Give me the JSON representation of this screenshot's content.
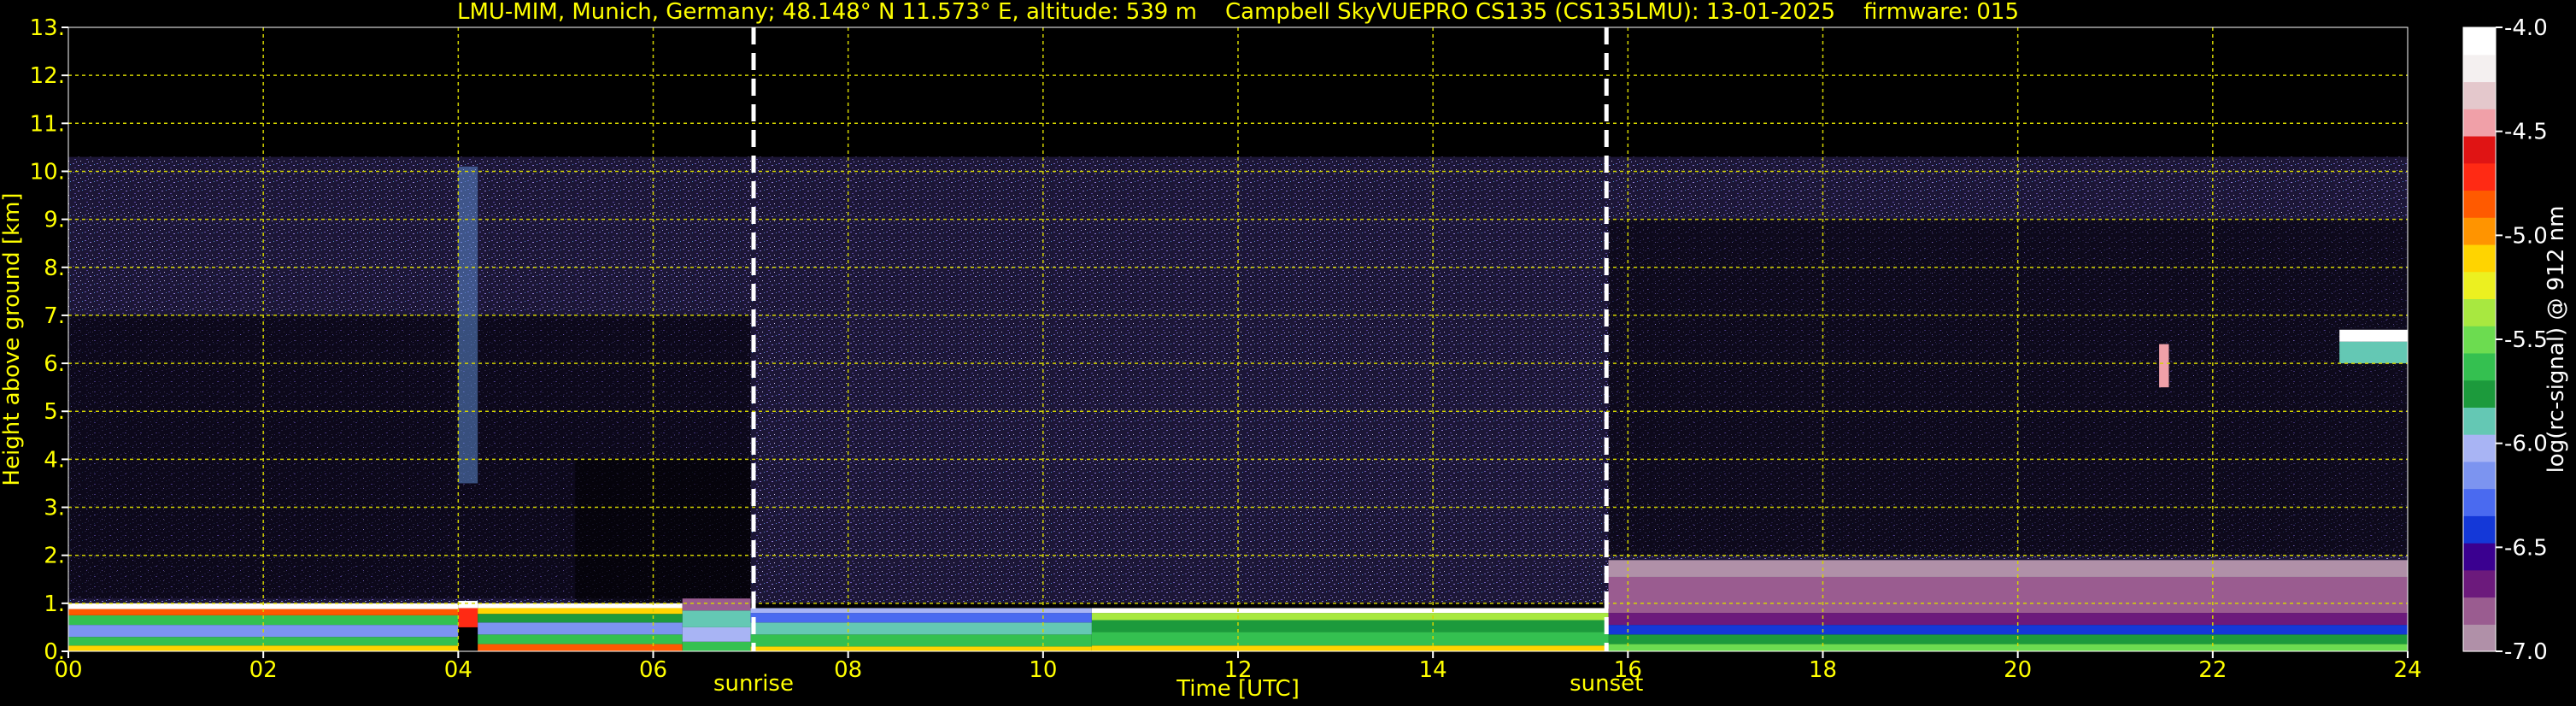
{
  "chart_data": {
    "type": "heatmap",
    "title": "LMU-MIM, Munich, Germany; 48.148° N 11.573° E, altitude: 539 m    Campbell SkyVUEPRO CS135 (CS135LMU): 13-01-2025    firmware: 015",
    "xlabel": "Time [UTC]",
    "ylabel": "Height above ground [km]",
    "xlim": [
      0,
      24
    ],
    "ylim": [
      0,
      13
    ],
    "x_ticks": [
      "00",
      "02",
      "04",
      "06",
      "08",
      "10",
      "12",
      "14",
      "16",
      "18",
      "20",
      "22",
      "24"
    ],
    "x_tick_values": [
      0,
      2,
      4,
      6,
      8,
      10,
      12,
      14,
      16,
      18,
      20,
      22,
      24
    ],
    "y_ticks": [
      "0.",
      "1.",
      "2.",
      "3.",
      "4.",
      "5.",
      "6.",
      "7.",
      "8.",
      "9.",
      "10.",
      "11.",
      "12.",
      "13."
    ],
    "y_tick_values": [
      0,
      1,
      2,
      3,
      4,
      5,
      6,
      7,
      8,
      9,
      10,
      11,
      12,
      13
    ],
    "grid": true,
    "colorbar": {
      "label": "log(rc-signal) @ 912 nm",
      "range": [
        -7.0,
        -4.0
      ],
      "tick_values": [
        -7.0,
        -6.5,
        -6.0,
        -5.5,
        -5.0,
        -4.5,
        -4.0
      ],
      "tick_labels": [
        "-7.0",
        "-6.5",
        "-6.0",
        "-5.5",
        "-5.0",
        "-4.5",
        "-4.0"
      ],
      "colors": [
        "#b090a8",
        "#9a5c90",
        "#6c1a7c",
        "#3a0090",
        "#1438d8",
        "#4a6af0",
        "#7c94f0",
        "#a8b4f4",
        "#64c8b4",
        "#1c9a3c",
        "#34c050",
        "#6cdc50",
        "#a8e840",
        "#ecf020",
        "#ffd400",
        "#ff9400",
        "#ff5a00",
        "#ff2a14",
        "#e01414",
        "#f0a0a8",
        "#e4c8cc",
        "#f4f0f0",
        "#ffffff"
      ]
    },
    "annotations": [
      {
        "label": "sunrise",
        "x": 7.03
      },
      {
        "label": "sunset",
        "x": 15.78
      }
    ],
    "features": [
      {
        "name": "boundary layer aerosol",
        "x_range": [
          0,
          24
        ],
        "height_range_km": [
          0.0,
          1.0
        ]
      },
      {
        "name": "noise / clear sky return",
        "x_range": [
          0,
          24
        ],
        "height_range_km": [
          1.0,
          10.3
        ]
      },
      {
        "name": "cloud",
        "x_range": [
          23.3,
          24
        ],
        "height_range_km": [
          6.0,
          6.7
        ]
      },
      {
        "name": "cloud",
        "x_range": [
          21.45,
          21.55
        ],
        "height_range_km": [
          5.5,
          6.4
        ]
      }
    ]
  }
}
